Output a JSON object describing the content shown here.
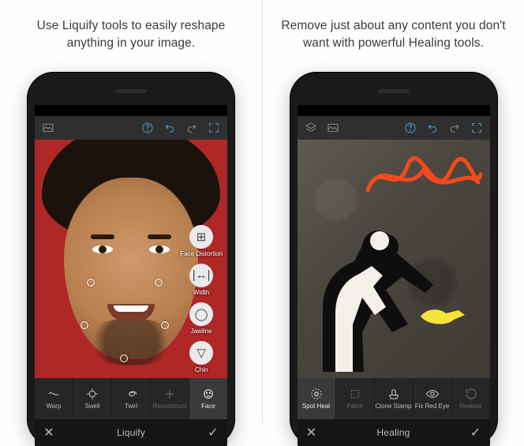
{
  "left": {
    "caption": "Use Liquify tools to easily reshape anything in your image.",
    "title": "Liquify",
    "options": [
      {
        "icon": "⊞",
        "label": "Face Distortion"
      },
      {
        "icon": "|↔|",
        "label": "Width"
      },
      {
        "icon": "◯",
        "label": "Jawline"
      },
      {
        "icon": "▽",
        "label": "Chin"
      }
    ],
    "tools": [
      {
        "label": "Warp",
        "dim": false,
        "sel": false
      },
      {
        "label": "Swell",
        "dim": false,
        "sel": false
      },
      {
        "label": "Twirl",
        "dim": false,
        "sel": false
      },
      {
        "label": "Reconstruct",
        "dim": true,
        "sel": false
      },
      {
        "label": "Face",
        "dim": false,
        "sel": true
      }
    ]
  },
  "right": {
    "caption": "Remove just about any content you don't want with powerful Healing tools.",
    "title": "Healing",
    "tools": [
      {
        "label": "Spot Heal",
        "dim": false,
        "sel": true
      },
      {
        "label": "Patch",
        "dim": true,
        "sel": false
      },
      {
        "label": "Clone Stamp",
        "dim": false,
        "sel": false
      },
      {
        "label": "Fix Red Eye",
        "dim": false,
        "sel": false
      },
      {
        "label": "Restore",
        "dim": true,
        "sel": false
      }
    ]
  }
}
